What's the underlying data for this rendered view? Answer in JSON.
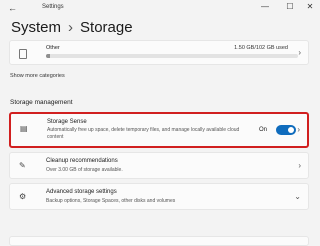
{
  "window": {
    "back_glyph": "←",
    "title": "Settings",
    "minimize_glyph": "—",
    "maximize_glyph": "☐",
    "close_glyph": "✕"
  },
  "breadcrumb": {
    "parent": "System",
    "separator": "›",
    "current": "Storage"
  },
  "other": {
    "label": "Other",
    "value": "1.50 GB/102 GB used",
    "usage_fraction": 0.015,
    "bar_color": "#8f8f8f"
  },
  "show_more": "Show more categories",
  "storage_management": {
    "title": "Storage management",
    "storage_sense": {
      "icon": "drive-icon",
      "title": "Storage Sense",
      "description": "Automatically free up space, delete temporary files, and manage locally available cloud content",
      "toggle_label": "On",
      "toggle_on": true,
      "accent": "#0f6cbd",
      "highlight_color": "#d11f1f"
    },
    "cleanup": {
      "icon": "cleanup-icon",
      "title": "Cleanup recommendations",
      "description": "Over 3.00 GB of storage available."
    },
    "advanced": {
      "icon": "gear-icon",
      "title": "Advanced storage settings",
      "description": "Backup options, Storage Spaces, other disks and volumes"
    }
  }
}
